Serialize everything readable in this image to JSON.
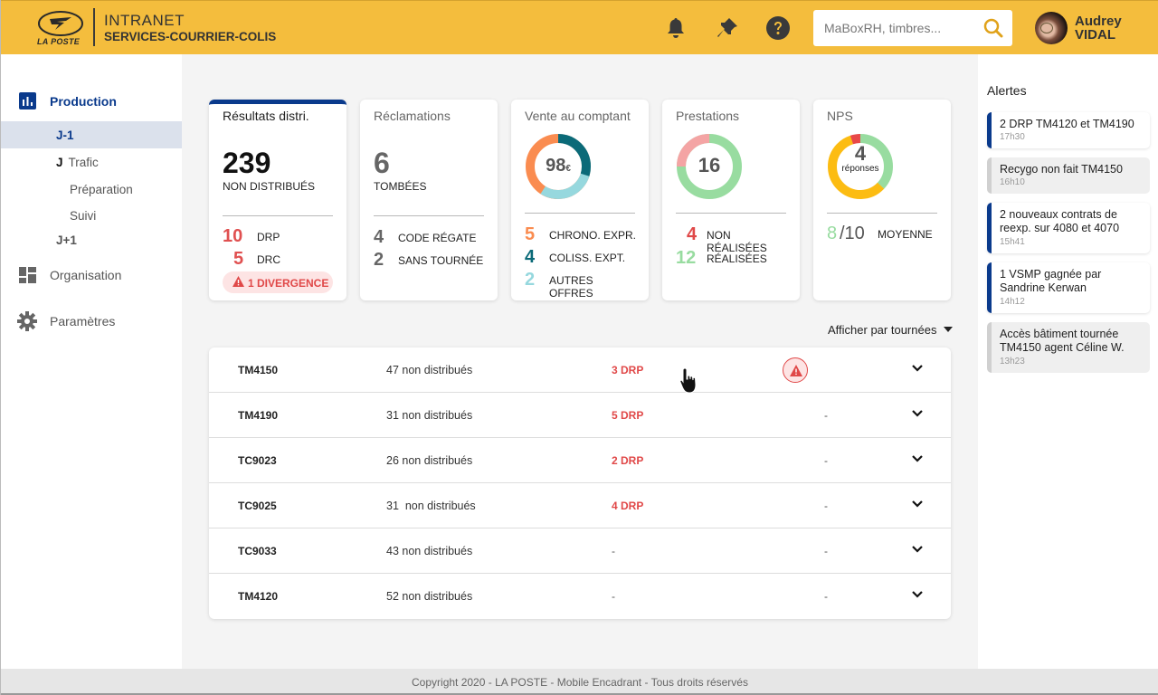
{
  "header": {
    "logo_text": "LA POSTE",
    "app_title": "INTRANET",
    "app_subtitle": "SERVICES-COURRIER-COLIS",
    "icons": [
      "bell-icon",
      "pin-icon",
      "help-icon"
    ],
    "search": {
      "placeholder": "MaBoxRH, timbres...",
      "value": ""
    },
    "user": {
      "first_name": "Audrey",
      "last_name": "VIDAL"
    },
    "brand_color": "#f4bd3d"
  },
  "sidebar": {
    "items": [
      {
        "label": "Production",
        "icon": "bar-chart-icon",
        "active": true
      },
      {
        "label": "Organisation",
        "icon": "dashboard-icon"
      },
      {
        "label": "Paramètres",
        "icon": "gear-icon"
      }
    ],
    "sub_items": [
      {
        "label": "J-1",
        "active": true
      },
      {
        "prefix": "J",
        "label": "Trafic"
      },
      {
        "label": "Préparation"
      },
      {
        "label": "Suivi"
      },
      {
        "label": "J+1"
      }
    ],
    "accent_color": "#0a3a8c"
  },
  "cards": {
    "resultats": {
      "title": "Résultats distri.",
      "value": "239",
      "label": "NON DISTRIBUÉS",
      "stats": [
        {
          "value": "10",
          "label": "DRP"
        },
        {
          "value": "5",
          "label": "DRC"
        }
      ],
      "badge": "1 DIVERGENCE"
    },
    "reclamations": {
      "title": "Réclamations",
      "value": "6",
      "label": "TOMBÉES",
      "stats": [
        {
          "value": "4",
          "label": "CODE RÉGATE"
        },
        {
          "value": "2",
          "label": "SANS TOURNÉE"
        }
      ]
    },
    "vente": {
      "title": "Vente au comptant",
      "center_value": "98",
      "center_unit": "€",
      "stats": [
        {
          "value": "5",
          "label": "CHRONO. EXPR.",
          "color": "#fa8c50"
        },
        {
          "value": "4",
          "label": "COLISS. EXPT.",
          "color": "#0b6a78"
        },
        {
          "value": "2",
          "label": "AUTRES OFFRES",
          "color": "#96d8de"
        }
      ]
    },
    "prestations": {
      "title": "Prestations",
      "center_value": "16",
      "stats": [
        {
          "value": "4",
          "label": "NON RÉALISÉES",
          "color": "#e04848",
          "ring_color": "#f4a4a4"
        },
        {
          "value": "12",
          "label": "RÉALISÉES",
          "color": "#98dca0",
          "ring_color": "#98dca0"
        }
      ]
    },
    "nps": {
      "title": "NPS",
      "center_value": "4",
      "center_label": "réponses",
      "score": "8",
      "score_max": "/10",
      "score_label": "MOYENNE",
      "ring": [
        {
          "name": "promoteurs",
          "fraction": 0.37,
          "color": "#98dca0"
        },
        {
          "name": "passifs",
          "fraction": 0.58,
          "color": "#fcbc12"
        },
        {
          "name": "détracteurs",
          "fraction": 0.05,
          "color": "#e84848"
        }
      ]
    }
  },
  "view_select": {
    "label": "Afficher par tournées"
  },
  "tours": [
    {
      "id": "TM4150",
      "non_distribues": "47 non distribués",
      "drp": "3 DRP",
      "divergence": "alert"
    },
    {
      "id": "TM4190",
      "non_distribues": "31 non distribués",
      "drp": "5 DRP",
      "divergence": "-"
    },
    {
      "id": "TC9023",
      "non_distribues": "26 non distribués",
      "drp": "2 DRP",
      "divergence": "-"
    },
    {
      "id": "TC9025",
      "non_distribues": "31  non distribués",
      "drp": "4 DRP",
      "divergence": "-"
    },
    {
      "id": "TC9033",
      "non_distribues": "43 non distribués",
      "drp": "-",
      "divergence": "-"
    },
    {
      "id": "TM4120",
      "non_distribues": "52 non distribués",
      "drp": "-",
      "divergence": "-"
    }
  ],
  "alerts": {
    "title": "Alertes",
    "items": [
      {
        "text": "2 DRP TM4120 et TM4190",
        "time": "17h30",
        "read": false
      },
      {
        "text": "Recygo non fait TM4150",
        "time": "16h10",
        "read": true
      },
      {
        "text": "2 nouveaux contrats de reexp. sur 4080 et 4070",
        "time": "15h41",
        "read": false
      },
      {
        "text": "1 VSMP gagnée par Sandrine Kerwan",
        "time": "14h12",
        "read": false
      },
      {
        "text": "Accès bâtiment tournée TM4150 agent Céline W.",
        "time": "13h23",
        "read": true
      }
    ]
  },
  "footer": {
    "text": "Copyright 2020 - LA POSTE - Mobile Encadrant - Tous droits réservés"
  }
}
